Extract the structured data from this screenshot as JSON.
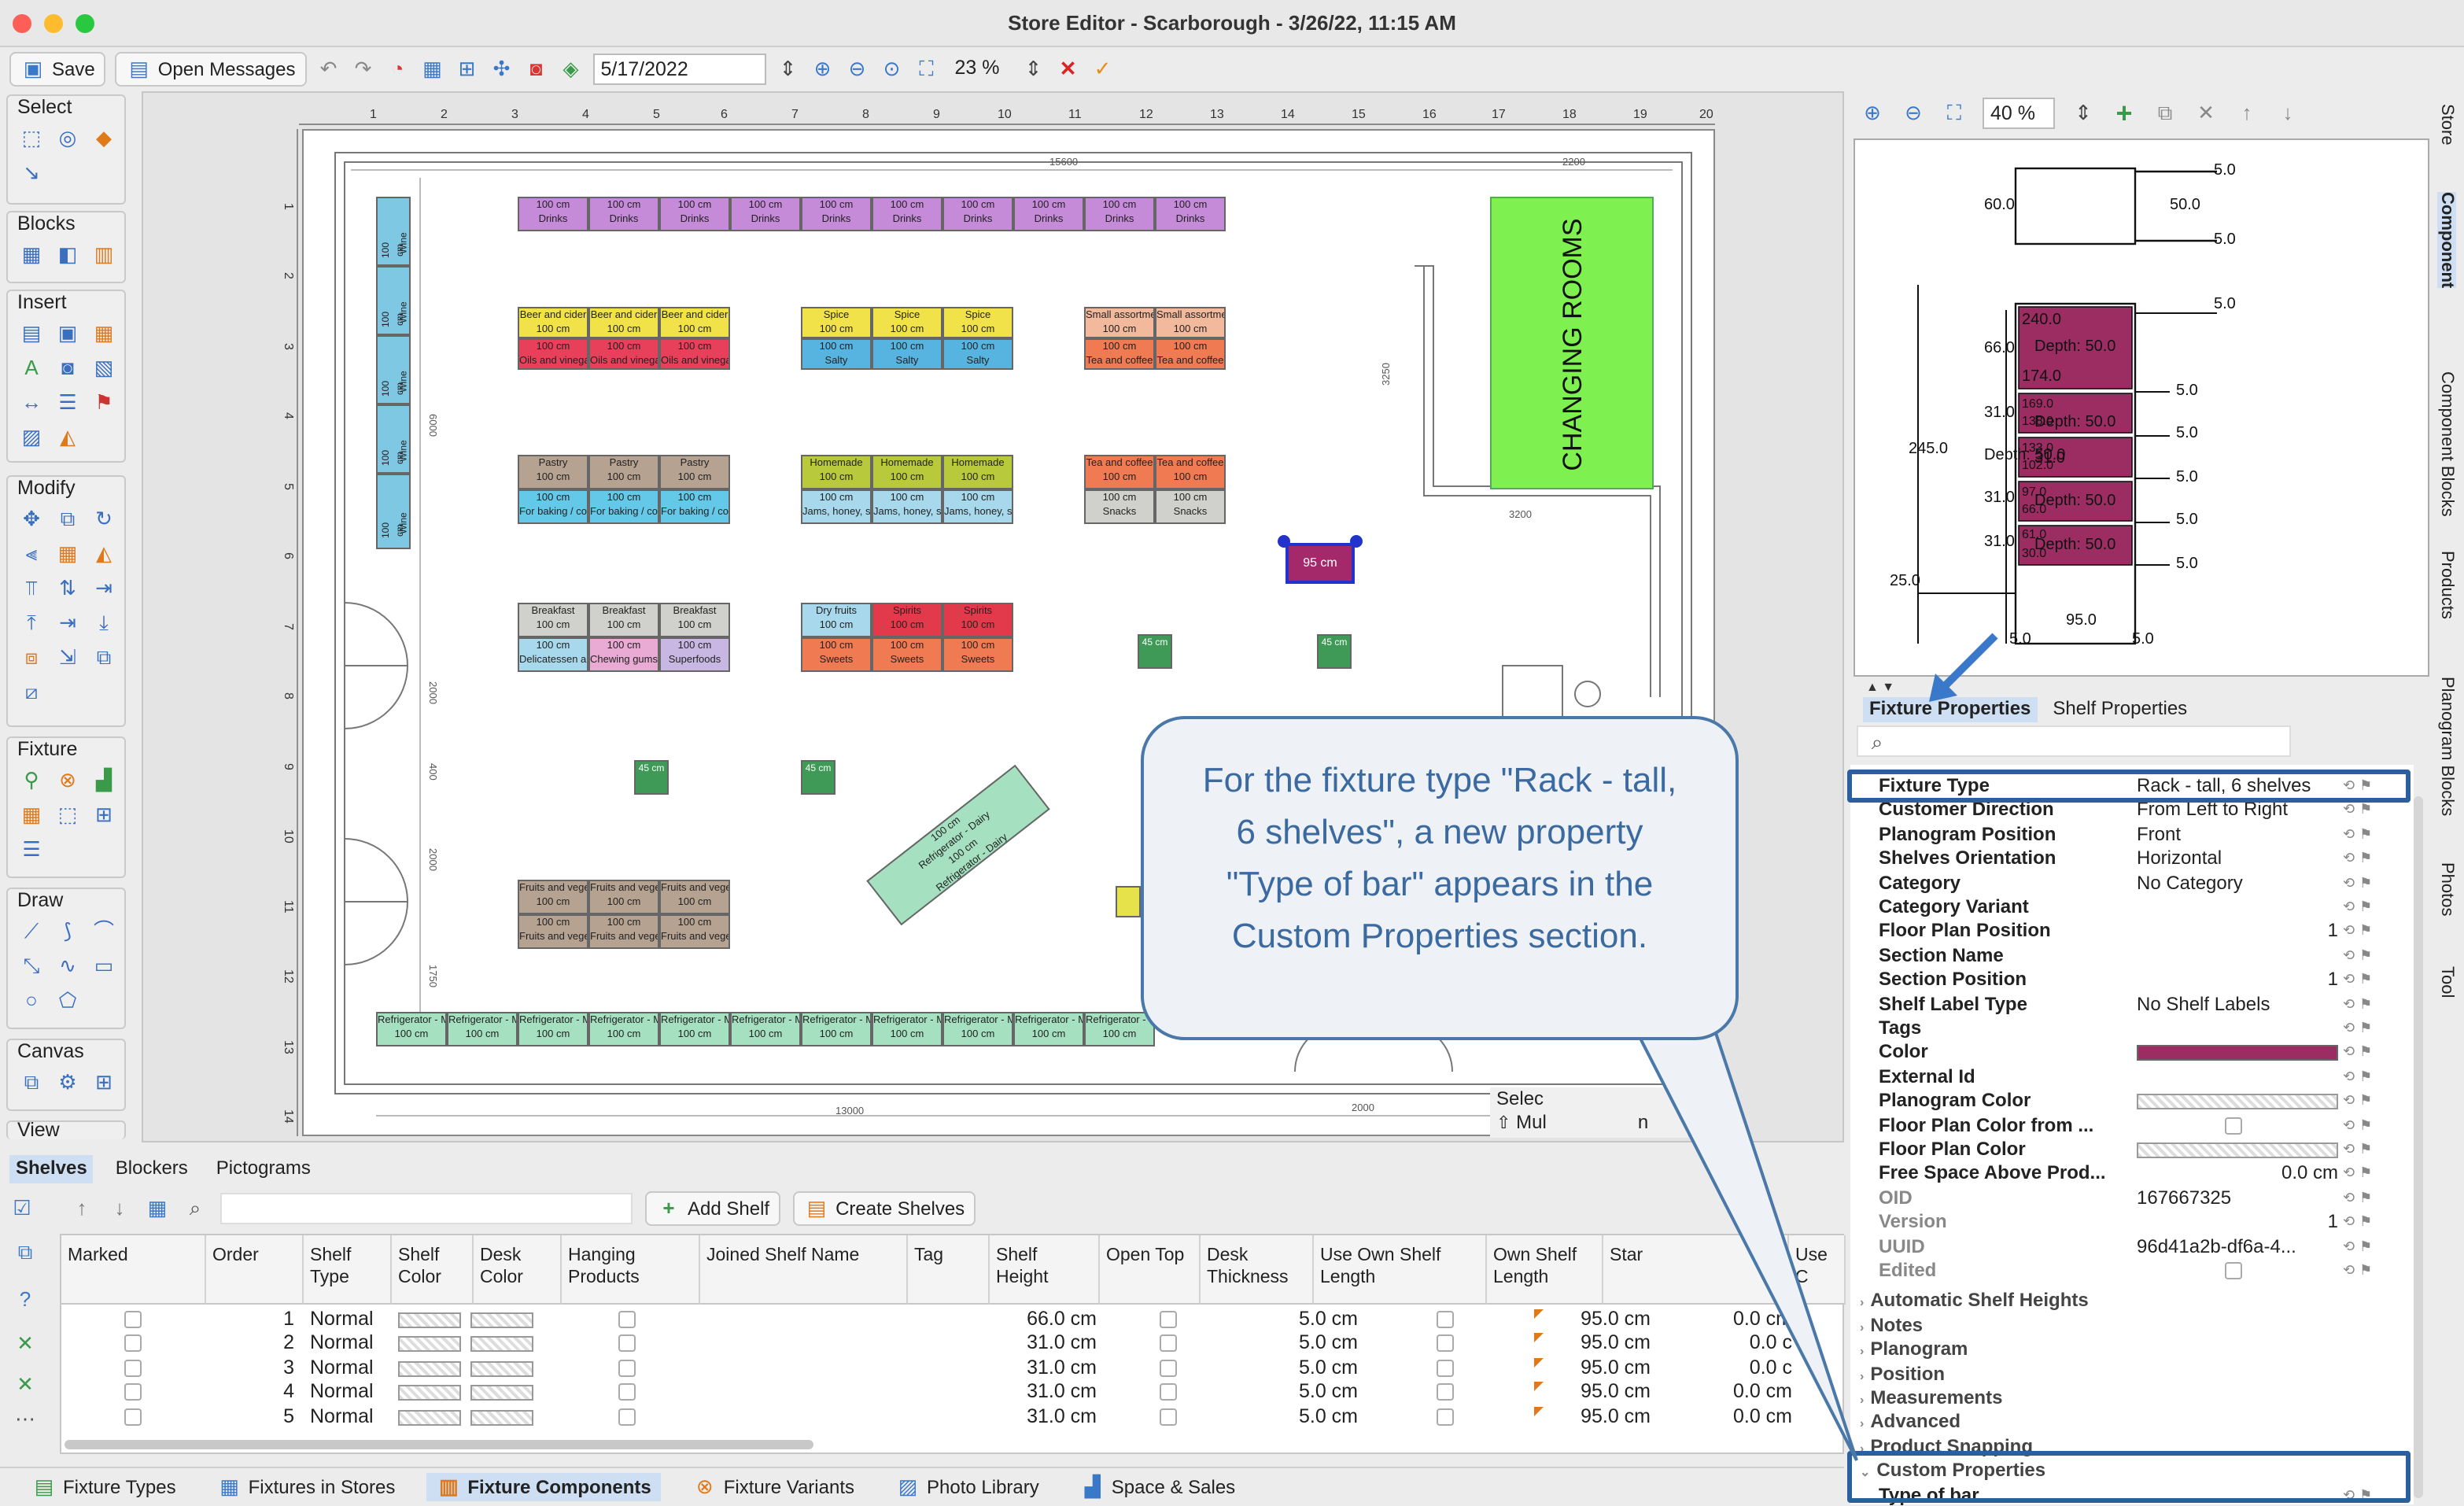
{
  "window": {
    "title": "Store Editor - Scarborough - 3/26/22, 11:15 AM"
  },
  "toolbar": {
    "save": "Save",
    "open_messages": "Open Messages",
    "date": "5/17/2022",
    "zoom": "23 %"
  },
  "tool_groups": [
    "Select",
    "Blocks",
    "Insert",
    "Modify",
    "Fixture",
    "Draw",
    "Canvas",
    "View"
  ],
  "plan": {
    "changing_rooms": "CHANGING ROOMS",
    "dims": [
      "15600",
      "2200",
      "6000",
      "3250",
      "3200",
      "2000",
      "400",
      "2000",
      "1750",
      "13000",
      "2000"
    ],
    "selection_partial": "Selec",
    "multi_partial": "Mul",
    "n_partial": "n",
    "wine_label": "100 cm",
    "wine_name": "Wine",
    "drinks": {
      "l1": "100 cm",
      "l2": "Drinks"
    },
    "beer": {
      "l1": "Beer and cider",
      "l2": "100 cm"
    },
    "oils": {
      "l1": "100 cm",
      "l2": "Oils and vinegars"
    },
    "spice": {
      "l1": "Spice",
      "l2": "100 cm"
    },
    "salty": {
      "l1": "100 cm",
      "l2": "Salty"
    },
    "small": {
      "l1": "Small assortment",
      "l2": "100 cm"
    },
    "tea_a": {
      "l1": "100 cm",
      "l2": "Tea and coffee"
    },
    "pastry": {
      "l1": "Pastry",
      "l2": "100 cm"
    },
    "baking": {
      "l1": "100 cm",
      "l2": "For baking / cooking"
    },
    "homemade": {
      "l1": "Homemade",
      "l2": "100 cm"
    },
    "jams": {
      "l1": "100 cm",
      "l2": "Jams, honey, sweet creams"
    },
    "tea_b": {
      "l1": "Tea and coffee",
      "l2": "100 cm"
    },
    "snacks": {
      "l1": "100 cm",
      "l2": "Snacks"
    },
    "breakfast": {
      "l1": "Breakfast",
      "l2": "100 cm"
    },
    "delicatessen": {
      "l1": "100 cm",
      "l2": "Delicatessen and selection"
    },
    "chewing": {
      "l1": "100 cm",
      "l2": "Chewing gums"
    },
    "superfoods": {
      "l1": "100 cm",
      "l2": "Superfoods"
    },
    "dryfruits": {
      "l1": "Dry fruits",
      "l2": "100 cm"
    },
    "spirits": {
      "l1": "Spirits",
      "l2": "100 cm"
    },
    "sweets": {
      "l1": "100 cm",
      "l2": "Sweets"
    },
    "fruits_a": {
      "l1": "Fruits and vegetables",
      "l2": "100 cm"
    },
    "fruits_b": {
      "l1": "100 cm",
      "l2": "Fruits and vegetables"
    },
    "fridge": {
      "l1": "Refrigerator - Meat",
      "l2": "100 cm"
    },
    "small_45": "45 cm",
    "selected_95": "95 cm",
    "diag": {
      "l1": "100 cm",
      "l2": "Refrigerator - Dairy"
    }
  },
  "bottom_tabs": [
    "Shelves",
    "Blockers",
    "Pictograms"
  ],
  "table_buttons": {
    "add_shelf": "Add Shelf",
    "create_shelves": "Create Shelves"
  },
  "table": {
    "headers": [
      "Marked",
      "Order",
      "Shelf Type",
      "Shelf Color",
      "Desk Color",
      "Hanging Products",
      "Joined Shelf Name",
      "Tag",
      "Shelf Height",
      "Open Top",
      "Desk Thickness",
      "Use Own Shelf Length",
      "Own Shelf Length",
      "Star",
      "Use C"
    ],
    "rows": [
      {
        "order": "1",
        "type": "Normal",
        "height": "66.0 cm",
        "thick": "5.0 cm",
        "own": "95.0 cm",
        "start": "0.0 cm"
      },
      {
        "order": "2",
        "type": "Normal",
        "height": "31.0 cm",
        "thick": "5.0 cm",
        "own": "95.0 cm",
        "start": "0.0 c"
      },
      {
        "order": "3",
        "type": "Normal",
        "height": "31.0 cm",
        "thick": "5.0 cm",
        "own": "95.0 cm",
        "start": "0.0 c"
      },
      {
        "order": "4",
        "type": "Normal",
        "height": "31.0 cm",
        "thick": "5.0 cm",
        "own": "95.0 cm",
        "start": "0.0 cm"
      },
      {
        "order": "5",
        "type": "Normal",
        "height": "31.0 cm",
        "thick": "5.0 cm",
        "own": "95.0 cm",
        "start": "0.0 cm"
      }
    ]
  },
  "view_tabs": [
    "Fixture Types",
    "Fixtures in Stores",
    "Fixture Components",
    "Fixture Variants",
    "Photo Library",
    "Space & Sales"
  ],
  "right_toolbar": {
    "zoom": "40 %"
  },
  "preview": {
    "labels": [
      "5.0",
      "60.0",
      "50.0",
      "5.0",
      "5.0",
      "240.0",
      "Depth: 50.0",
      "66.0",
      "174.0",
      "5.0",
      "169.0",
      "138.0",
      "Depth: 50.0",
      "31.0",
      "5.0",
      "245.0",
      "133.0",
      "102.0",
      "31.0",
      "Depth: 50.0",
      "5.0",
      "97.0",
      "66.0",
      "31.0",
      "Depth: 50.0",
      "5.0",
      "61.0",
      "30.0",
      "31.0",
      "Depth: 50.0",
      "5.0",
      "25.0",
      "95.0",
      "5.0",
      "5.0"
    ]
  },
  "prop_tabs": [
    "Fixture Properties",
    "Shelf Properties"
  ],
  "properties": [
    {
      "label": "Fixture Type",
      "value": "Rack - tall, 6 shelves"
    },
    {
      "label": "Customer Direction",
      "value": "From Left to Right"
    },
    {
      "label": "Planogram Position",
      "value": "Front"
    },
    {
      "label": "Shelves Orientation",
      "value": "Horizontal"
    },
    {
      "label": "Category",
      "value": "No Category"
    },
    {
      "label": "Category Variant",
      "value": ""
    },
    {
      "label": "Floor Plan Position",
      "value": "1"
    },
    {
      "label": "Section Name",
      "value": ""
    },
    {
      "label": "Section Position",
      "value": "1"
    },
    {
      "label": "Shelf Label Type",
      "value": "No Shelf Labels"
    },
    {
      "label": "Tags",
      "value": ""
    },
    {
      "label": "Color",
      "value": ""
    },
    {
      "label": "External Id",
      "value": ""
    },
    {
      "label": "Planogram Color",
      "value": ""
    },
    {
      "label": "Floor Plan Color from ...",
      "value": ""
    },
    {
      "label": "Floor Plan Color",
      "value": ""
    },
    {
      "label": "Free Space Above Prod...",
      "value": "0.0 cm"
    },
    {
      "label": "OID",
      "value": "167667325"
    },
    {
      "label": "Version",
      "value": "1"
    },
    {
      "label": "UUID",
      "value": "96d41a2b-df6a-4..."
    },
    {
      "label": "Edited",
      "value": ""
    }
  ],
  "sections": [
    "Automatic Shelf Heights",
    "Notes",
    "Planogram",
    "Position",
    "Measurements",
    "Advanced",
    "Product Snapping",
    "Custom Properties"
  ],
  "custom": {
    "type_of_bar": "Type of bar"
  },
  "side_tabs": [
    "Store",
    "Component",
    "Component Blocks",
    "Products",
    "Planogram Blocks",
    "Photos",
    "Tool"
  ],
  "callout": {
    "text": "For the fixture type \"Rack - tall, 6 shelves\", a new property \"Type of bar\" appears in the Custom Properties section."
  },
  "colors": {
    "accent": "#2b5f9e",
    "color_swatch": "#9b2d62",
    "changing_rooms": "#7ef04f"
  }
}
